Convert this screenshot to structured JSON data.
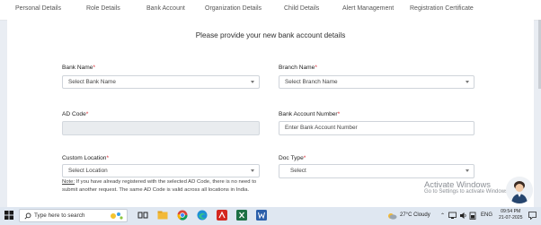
{
  "tabs": [
    {
      "label": "Personal Details"
    },
    {
      "label": "Role Details"
    },
    {
      "label": "Bank Account"
    },
    {
      "label": "Organization Details"
    },
    {
      "label": "Child Details"
    },
    {
      "label": "Alert Management"
    },
    {
      "label": "Registration Certificate"
    }
  ],
  "form": {
    "heading": "Please provide your new bank account details",
    "required_marker": "*",
    "bank_name": {
      "label": "Bank Name",
      "value": "Select Bank Name"
    },
    "branch_name": {
      "label": "Branch Name",
      "value": "Select Branch Name"
    },
    "ad_code": {
      "label": "AD Code",
      "value": ""
    },
    "bank_account_number": {
      "label": "Bank Account Number",
      "placeholder": "Enter Bank Account Number"
    },
    "custom_location": {
      "label": "Custom Location",
      "value": "Select Location"
    },
    "doc_type": {
      "label": "Doc Type",
      "value": "Select"
    },
    "note_title": "Note:",
    "note_text": " If you have already registered with the selected AD Code, there is no need to submit another request. The same AD Code is valid across all locations in India."
  },
  "watermark": {
    "line1": "Activate Windows",
    "line2": "Go to Settings to activate Windows."
  },
  "taskbar": {
    "search_placeholder": "Type here to search",
    "weather": "27°C  Cloudy",
    "language": "ENG",
    "time": "09:54 PM",
    "date": "21-07-2025"
  },
  "colors": {
    "required": "#d9232d",
    "page_background": "#e9edf3",
    "taskbar": "#dfe7f1"
  }
}
